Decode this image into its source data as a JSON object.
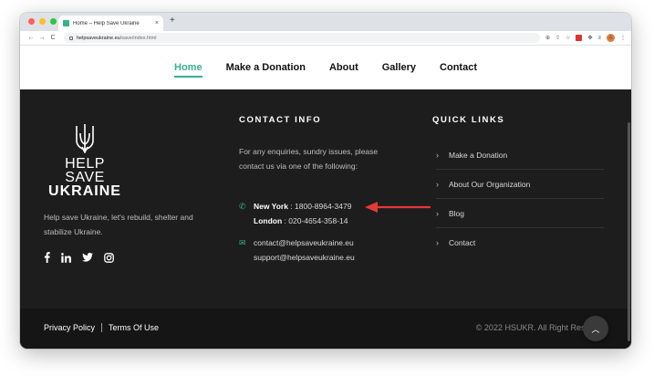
{
  "browser": {
    "tab_title": "Home – Help Save Ukraine",
    "tab_close": "×",
    "new_tab": "+",
    "url_host": "helpsaveukraine.eu",
    "url_path": "/save/index.html",
    "profile_initial": "A",
    "nav_back": "←",
    "nav_forward": "→",
    "nav_reload": "C"
  },
  "site_nav": {
    "items": [
      "Home",
      "Make a Donation",
      "About",
      "Gallery",
      "Contact"
    ],
    "active": "Home"
  },
  "brand": {
    "line1": "HELP SAVE",
    "line2": "UKRAINE"
  },
  "about_text": "Help save Ukraine, let's rebuild, shelter and stabilize Ukraine.",
  "socials": [
    "facebook",
    "linkedin",
    "twitter",
    "instagram"
  ],
  "contact": {
    "heading": "CONTACT INFO",
    "intro": "For any enquiries, sundry issues, please contact us via one of the following:",
    "phone1_label": "New York",
    "phone1_value": ": 1800-8964-3479",
    "phone2_label": "London",
    "phone2_value": ": 020-4654-358-14",
    "email1": "contact@helpsaveukraine.eu",
    "email2": "support@helpsaveukraine.eu"
  },
  "quick_links": {
    "heading": "QUICK LINKS",
    "items": [
      "Make a Donation",
      "About Our Organization",
      "Blog",
      "Contact"
    ]
  },
  "legal": {
    "privacy": "Privacy Policy",
    "terms": "Terms Of Use"
  },
  "copyright": "© 2022 HSUKR. All Right Reserved",
  "colors": {
    "accent": "#35b38a",
    "footer_bg": "#1d1d1d",
    "arrow": "#e53935"
  },
  "icons": {
    "back_to_top": "chevron-up-icon",
    "phone": "phone-icon",
    "email": "envelope-icon",
    "link_chevron": "chevron-right-icon"
  }
}
